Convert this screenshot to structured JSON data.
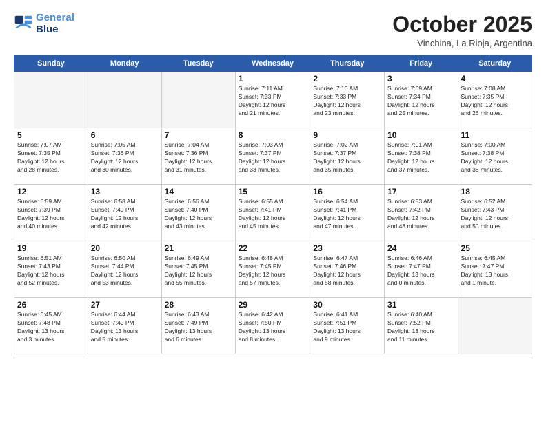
{
  "header": {
    "logo_line1": "General",
    "logo_line2": "Blue",
    "month": "October 2025",
    "location": "Vinchina, La Rioja, Argentina"
  },
  "days_of_week": [
    "Sunday",
    "Monday",
    "Tuesday",
    "Wednesday",
    "Thursday",
    "Friday",
    "Saturday"
  ],
  "weeks": [
    [
      {
        "day": "",
        "info": ""
      },
      {
        "day": "",
        "info": ""
      },
      {
        "day": "",
        "info": ""
      },
      {
        "day": "1",
        "info": "Sunrise: 7:11 AM\nSunset: 7:33 PM\nDaylight: 12 hours\nand 21 minutes."
      },
      {
        "day": "2",
        "info": "Sunrise: 7:10 AM\nSunset: 7:33 PM\nDaylight: 12 hours\nand 23 minutes."
      },
      {
        "day": "3",
        "info": "Sunrise: 7:09 AM\nSunset: 7:34 PM\nDaylight: 12 hours\nand 25 minutes."
      },
      {
        "day": "4",
        "info": "Sunrise: 7:08 AM\nSunset: 7:35 PM\nDaylight: 12 hours\nand 26 minutes."
      }
    ],
    [
      {
        "day": "5",
        "info": "Sunrise: 7:07 AM\nSunset: 7:35 PM\nDaylight: 12 hours\nand 28 minutes."
      },
      {
        "day": "6",
        "info": "Sunrise: 7:05 AM\nSunset: 7:36 PM\nDaylight: 12 hours\nand 30 minutes."
      },
      {
        "day": "7",
        "info": "Sunrise: 7:04 AM\nSunset: 7:36 PM\nDaylight: 12 hours\nand 31 minutes."
      },
      {
        "day": "8",
        "info": "Sunrise: 7:03 AM\nSunset: 7:37 PM\nDaylight: 12 hours\nand 33 minutes."
      },
      {
        "day": "9",
        "info": "Sunrise: 7:02 AM\nSunset: 7:37 PM\nDaylight: 12 hours\nand 35 minutes."
      },
      {
        "day": "10",
        "info": "Sunrise: 7:01 AM\nSunset: 7:38 PM\nDaylight: 12 hours\nand 37 minutes."
      },
      {
        "day": "11",
        "info": "Sunrise: 7:00 AM\nSunset: 7:38 PM\nDaylight: 12 hours\nand 38 minutes."
      }
    ],
    [
      {
        "day": "12",
        "info": "Sunrise: 6:59 AM\nSunset: 7:39 PM\nDaylight: 12 hours\nand 40 minutes."
      },
      {
        "day": "13",
        "info": "Sunrise: 6:58 AM\nSunset: 7:40 PM\nDaylight: 12 hours\nand 42 minutes."
      },
      {
        "day": "14",
        "info": "Sunrise: 6:56 AM\nSunset: 7:40 PM\nDaylight: 12 hours\nand 43 minutes."
      },
      {
        "day": "15",
        "info": "Sunrise: 6:55 AM\nSunset: 7:41 PM\nDaylight: 12 hours\nand 45 minutes."
      },
      {
        "day": "16",
        "info": "Sunrise: 6:54 AM\nSunset: 7:41 PM\nDaylight: 12 hours\nand 47 minutes."
      },
      {
        "day": "17",
        "info": "Sunrise: 6:53 AM\nSunset: 7:42 PM\nDaylight: 12 hours\nand 48 minutes."
      },
      {
        "day": "18",
        "info": "Sunrise: 6:52 AM\nSunset: 7:43 PM\nDaylight: 12 hours\nand 50 minutes."
      }
    ],
    [
      {
        "day": "19",
        "info": "Sunrise: 6:51 AM\nSunset: 7:43 PM\nDaylight: 12 hours\nand 52 minutes."
      },
      {
        "day": "20",
        "info": "Sunrise: 6:50 AM\nSunset: 7:44 PM\nDaylight: 12 hours\nand 53 minutes."
      },
      {
        "day": "21",
        "info": "Sunrise: 6:49 AM\nSunset: 7:45 PM\nDaylight: 12 hours\nand 55 minutes."
      },
      {
        "day": "22",
        "info": "Sunrise: 6:48 AM\nSunset: 7:45 PM\nDaylight: 12 hours\nand 57 minutes."
      },
      {
        "day": "23",
        "info": "Sunrise: 6:47 AM\nSunset: 7:46 PM\nDaylight: 12 hours\nand 58 minutes."
      },
      {
        "day": "24",
        "info": "Sunrise: 6:46 AM\nSunset: 7:47 PM\nDaylight: 13 hours\nand 0 minutes."
      },
      {
        "day": "25",
        "info": "Sunrise: 6:45 AM\nSunset: 7:47 PM\nDaylight: 13 hours\nand 1 minute."
      }
    ],
    [
      {
        "day": "26",
        "info": "Sunrise: 6:45 AM\nSunset: 7:48 PM\nDaylight: 13 hours\nand 3 minutes."
      },
      {
        "day": "27",
        "info": "Sunrise: 6:44 AM\nSunset: 7:49 PM\nDaylight: 13 hours\nand 5 minutes."
      },
      {
        "day": "28",
        "info": "Sunrise: 6:43 AM\nSunset: 7:49 PM\nDaylight: 13 hours\nand 6 minutes."
      },
      {
        "day": "29",
        "info": "Sunrise: 6:42 AM\nSunset: 7:50 PM\nDaylight: 13 hours\nand 8 minutes."
      },
      {
        "day": "30",
        "info": "Sunrise: 6:41 AM\nSunset: 7:51 PM\nDaylight: 13 hours\nand 9 minutes."
      },
      {
        "day": "31",
        "info": "Sunrise: 6:40 AM\nSunset: 7:52 PM\nDaylight: 13 hours\nand 11 minutes."
      },
      {
        "day": "",
        "info": ""
      }
    ]
  ]
}
